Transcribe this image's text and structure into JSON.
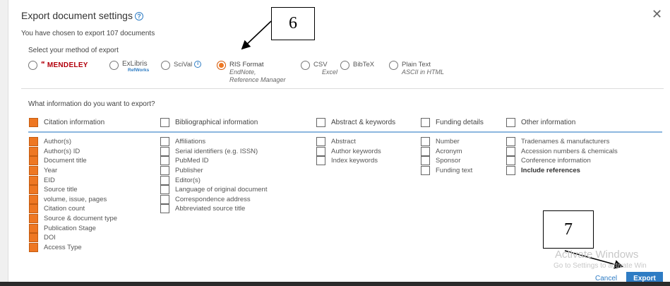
{
  "dialog": {
    "title": "Export document settings",
    "help_icon": "?",
    "close_icon": "✕",
    "subtitle": "You have chosen to export 107 documents",
    "method_label": "Select your method of export",
    "info_label": "What information do you want to export?"
  },
  "methods": {
    "mendeley": {
      "label": "MENDELEY",
      "logo_glyph": "🙶",
      "selected": false
    },
    "exlibris": {
      "label": "ExLibris",
      "sub": "RefWorks",
      "selected": false
    },
    "scival": {
      "label": "SciVal",
      "info_icon": "i",
      "selected": false
    },
    "ris": {
      "label": "RIS Format",
      "sub1": "EndNote,",
      "sub2": "Reference Manager",
      "selected": true
    },
    "csv": {
      "label": "CSV",
      "sub": "Excel",
      "selected": false
    },
    "bibtex": {
      "label": "BibTeX",
      "selected": false
    },
    "plaintext": {
      "label": "Plain Text",
      "sub": "ASCII in HTML",
      "selected": false
    }
  },
  "categories": [
    {
      "label": "Citation information",
      "checked": true
    },
    {
      "label": "Bibliographical information",
      "checked": false
    },
    {
      "label": "Abstract & keywords",
      "checked": false
    },
    {
      "label": "Funding details",
      "checked": false
    },
    {
      "label": "Other information",
      "checked": false
    }
  ],
  "columns": {
    "citation": [
      "Author(s)",
      "Author(s) ID",
      "Document title",
      "Year",
      "EID",
      "Source title",
      "volume, issue, pages",
      "Citation count",
      "Source & document type",
      "Publication Stage",
      "DOI",
      "Access Type"
    ],
    "bibliographical": [
      "Affiliations",
      "Serial identifiers (e.g. ISSN)",
      "PubMed ID",
      "Publisher",
      "Editor(s)",
      "Language of original document",
      "Correspondence address",
      "Abbreviated source title"
    ],
    "abstract": [
      "Abstract",
      "Author keywords",
      "Index keywords"
    ],
    "funding": [
      "Number",
      "Acronym",
      "Sponsor",
      "Funding text"
    ],
    "other": [
      "Tradenames & manufacturers",
      "Accession numbers & chemicals",
      "Conference information",
      "Include references"
    ]
  },
  "annotations": {
    "six": "6",
    "seven": "7"
  },
  "watermark": {
    "line1": "Activate Windows",
    "line2": "Go to Settings to activate Win"
  },
  "footer": {
    "cancel": "Cancel",
    "export": "Export"
  },
  "colors": {
    "accent": "#2e7cc4",
    "checked": "#ee7722",
    "mendeley": "#b3000c"
  }
}
